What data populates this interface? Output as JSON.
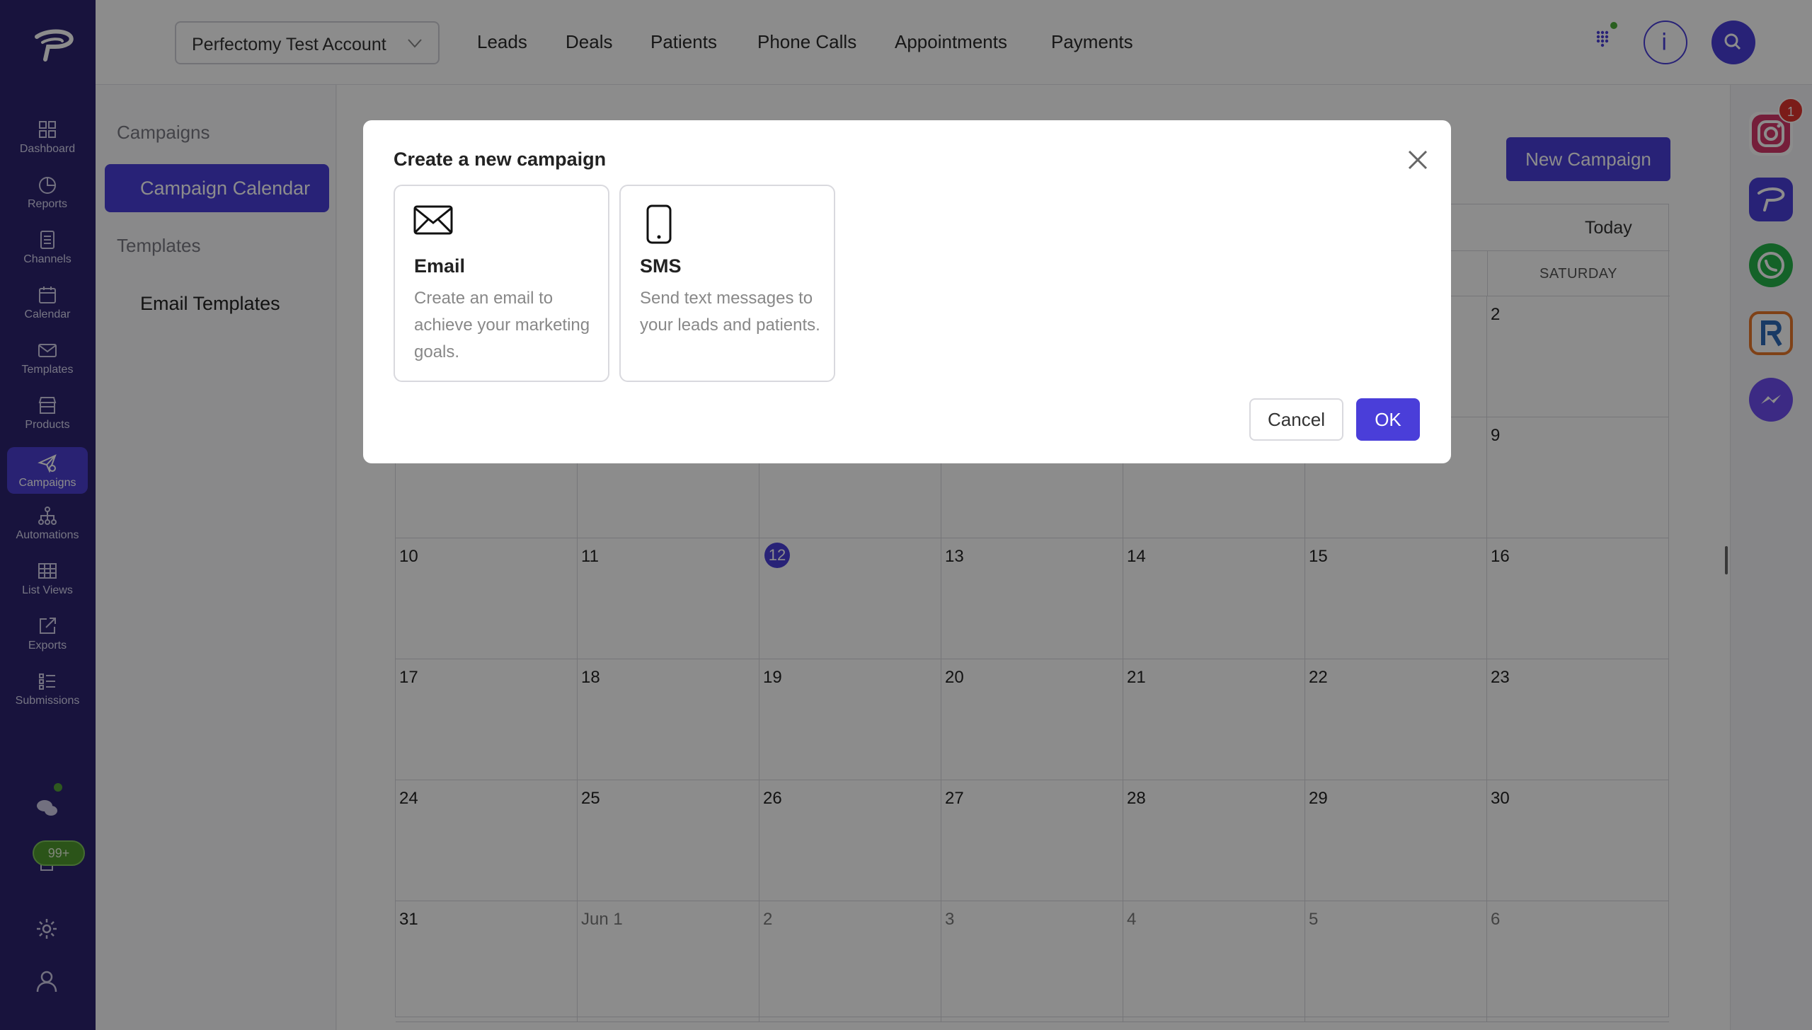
{
  "nav": {
    "items": [
      {
        "label": "Dashboard",
        "icon": "dashboard-icon"
      },
      {
        "label": "Reports",
        "icon": "pie-chart-icon"
      },
      {
        "label": "Channels",
        "icon": "document-icon"
      },
      {
        "label": "Calendar",
        "icon": "calendar-icon"
      },
      {
        "label": "Templates",
        "icon": "mail-icon"
      },
      {
        "label": "Products",
        "icon": "store-icon"
      },
      {
        "label": "Campaigns",
        "icon": "send-icon"
      },
      {
        "label": "Automations",
        "icon": "hierarchy-icon"
      },
      {
        "label": "List Views",
        "icon": "table-icon"
      },
      {
        "label": "Exports",
        "icon": "export-icon"
      },
      {
        "label": "Submissions",
        "icon": "list-icon"
      }
    ],
    "active": "Campaigns",
    "notification_count": "99+"
  },
  "topbar": {
    "account": "Perfectomy Test Account",
    "links": [
      "Leads",
      "Deals",
      "Patients",
      "Phone Calls",
      "Appointments",
      "Payments"
    ]
  },
  "subnav": {
    "section_campaigns": "Campaigns",
    "campaign_calendar": "Campaign Calendar",
    "section_templates": "Templates",
    "email_templates": "Email Templates"
  },
  "main": {
    "new_campaign": "New Campaign",
    "today": "Today",
    "visible_dayname": "SATURDAY"
  },
  "calendar": {
    "weeks": [
      [
        "",
        "",
        "",
        "",
        "",
        "",
        "2"
      ],
      [
        "",
        "",
        "",
        "",
        "",
        "",
        "9"
      ],
      [
        "10",
        "11",
        "12",
        "13",
        "14",
        "15",
        "16"
      ],
      [
        "17",
        "18",
        "19",
        "20",
        "21",
        "22",
        "23"
      ],
      [
        "24",
        "25",
        "26",
        "27",
        "28",
        "29",
        "30"
      ],
      [
        "31",
        "Jun 1",
        "2",
        "3",
        "4",
        "5",
        "6"
      ]
    ],
    "today": "12"
  },
  "rail": {
    "instagram_badge": "1",
    "icons": [
      "instagram-icon",
      "perfectomy-chat-icon",
      "whatsapp-icon",
      "r-app-icon",
      "messenger-icon"
    ]
  },
  "modal": {
    "title": "Create a new campaign",
    "options": [
      {
        "title": "Email",
        "description": "Create an email to achieve your marketing goals.",
        "icon": "envelope-icon"
      },
      {
        "title": "SMS",
        "description": "Send text messages to your leads and patients.",
        "icon": "phone-icon"
      }
    ],
    "cancel": "Cancel",
    "ok": "OK"
  },
  "colors": {
    "sidebar": "#2c2470",
    "accent": "#4a3ed9",
    "badge_green": "#4f9a2e",
    "badge_red": "#e0332f"
  }
}
